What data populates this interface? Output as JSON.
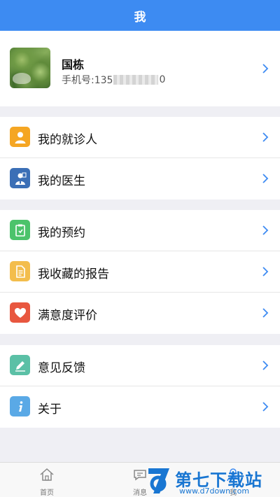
{
  "header": {
    "title": "我"
  },
  "profile": {
    "name": "国栋",
    "phone_prefix": "手机号:135",
    "phone_suffix": "0"
  },
  "groups": [
    {
      "items": [
        {
          "label": "我的就诊人",
          "icon": "patient-icon",
          "color": "#f5a623"
        },
        {
          "label": "我的医生",
          "icon": "doctor-icon",
          "color": "#3b6fb6"
        }
      ]
    },
    {
      "items": [
        {
          "label": "我的预约",
          "icon": "appointment-icon",
          "color": "#4cc36b"
        },
        {
          "label": "我收藏的报告",
          "icon": "report-icon",
          "color": "#f3bd4c"
        },
        {
          "label": "满意度评价",
          "icon": "heart-icon",
          "color": "#e8573f"
        }
      ]
    },
    {
      "items": [
        {
          "label": "意见反馈",
          "icon": "pencil-icon",
          "color": "#5bc0a6"
        },
        {
          "label": "关于",
          "icon": "info-icon",
          "color": "#5aa9e6"
        }
      ]
    }
  ],
  "tabbar": {
    "tabs": [
      {
        "label": "首页",
        "icon": "home-icon"
      },
      {
        "label": "消息",
        "icon": "message-icon"
      },
      {
        "label": "我",
        "icon": "me-icon"
      }
    ]
  },
  "watermark": {
    "text": "第七下载站",
    "url": "www.d7down.com",
    "color": "#1976d2"
  },
  "colors": {
    "accent": "#3d8bf2",
    "chevron": "#3d8bf2",
    "background": "#efeff4"
  }
}
